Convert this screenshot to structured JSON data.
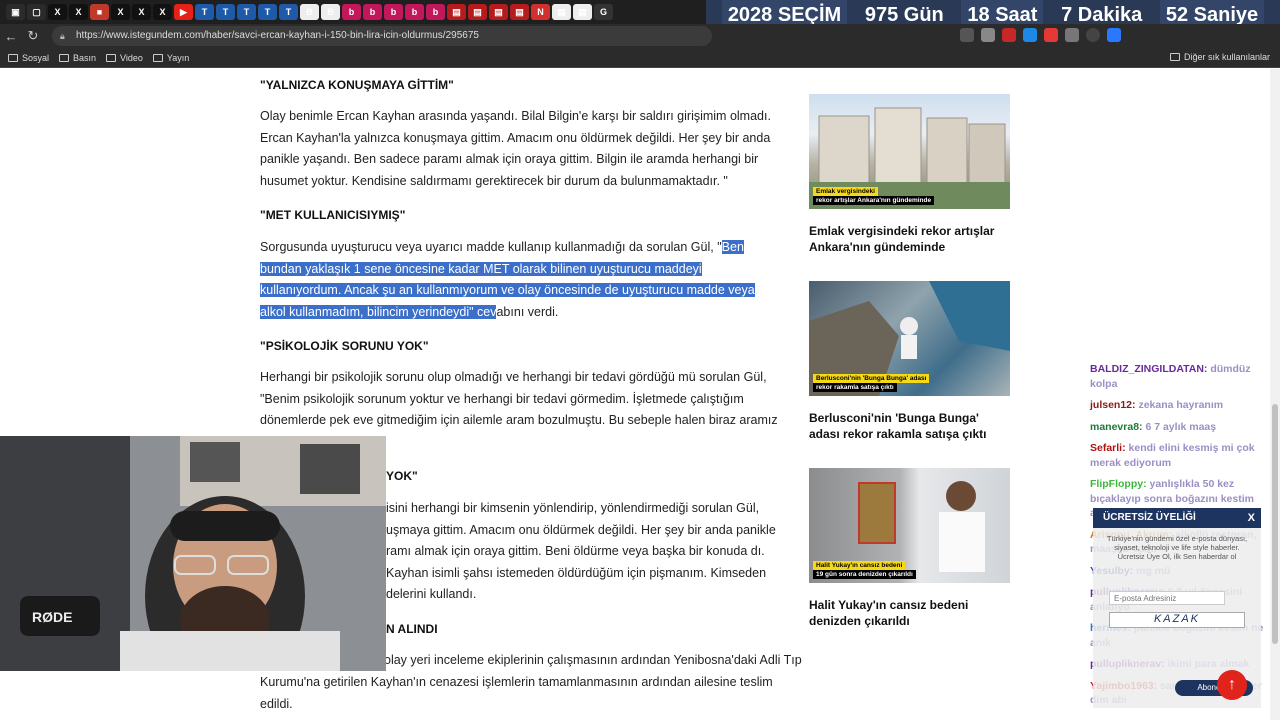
{
  "browser": {
    "tabs": [
      {
        "icon": "tab-icon",
        "color": "#2b2b2b",
        "glyph": "▣"
      },
      {
        "icon": "tab-icon",
        "color": "#2b2b2b",
        "glyph": "▢"
      },
      {
        "icon": "x-icon",
        "color": "#111",
        "glyph": "X"
      },
      {
        "icon": "x-icon",
        "color": "#111",
        "glyph": "X"
      },
      {
        "icon": "red-icon",
        "color": "#c0392b",
        "glyph": "■"
      },
      {
        "icon": "x-icon",
        "color": "#111",
        "glyph": "X"
      },
      {
        "icon": "x-icon",
        "color": "#111",
        "glyph": "X"
      },
      {
        "icon": "x-icon",
        "color": "#111",
        "glyph": "X"
      },
      {
        "icon": "youtube-icon",
        "color": "#e62117",
        "glyph": "▶"
      },
      {
        "icon": "t24-icon",
        "color": "#1e5aa8",
        "glyph": "T"
      },
      {
        "icon": "t24-icon",
        "color": "#1e5aa8",
        "glyph": "T"
      },
      {
        "icon": "t24-icon",
        "color": "#1e5aa8",
        "glyph": "T"
      },
      {
        "icon": "t24-icon",
        "color": "#1e5aa8",
        "glyph": "T"
      },
      {
        "icon": "t24-icon",
        "color": "#1e5aa8",
        "glyph": "T"
      },
      {
        "icon": "b-icon",
        "color": "#eee",
        "glyph": "B"
      },
      {
        "icon": "b-icon",
        "color": "#eee",
        "glyph": "B"
      },
      {
        "icon": "b-icon",
        "color": "#c2185b",
        "glyph": "b"
      },
      {
        "icon": "b-icon",
        "color": "#c2185b",
        "glyph": "b"
      },
      {
        "icon": "b-icon",
        "color": "#c2185b",
        "glyph": "b"
      },
      {
        "icon": "b-icon",
        "color": "#c2185b",
        "glyph": "b"
      },
      {
        "icon": "b-icon",
        "color": "#c2185b",
        "glyph": "b"
      },
      {
        "icon": "news-icon",
        "color": "#b71c1c",
        "glyph": "▤"
      },
      {
        "icon": "news-icon",
        "color": "#b71c1c",
        "glyph": "▤"
      },
      {
        "icon": "news-icon",
        "color": "#b71c1c",
        "glyph": "▤"
      },
      {
        "icon": "news-icon",
        "color": "#b71c1c",
        "glyph": "▤"
      },
      {
        "icon": "n-icon",
        "color": "#d32f2f",
        "glyph": "N"
      },
      {
        "icon": "doc-icon",
        "color": "#eee",
        "glyph": "▤"
      },
      {
        "icon": "doc-icon",
        "color": "#eee",
        "glyph": "▤"
      },
      {
        "icon": "g-icon",
        "color": "#333",
        "glyph": "G"
      }
    ],
    "countdown": {
      "year_label": "2028",
      "title": "SEÇİM",
      "days": "975 Gün",
      "hours": "18 Saat",
      "minutes": "7 Dakika",
      "seconds": "52 Saniye"
    },
    "url": "https://www.istegundem.com/haber/savci-ercan-kayhan-i-150-bin-lira-icin-oldurmus/295675",
    "bookmarks": [
      "Sosyal",
      "Basın",
      "Video",
      "Yayın"
    ],
    "bookmarks_other": "Diğer sık kullanılanlar"
  },
  "article": {
    "h1": "\"YALNIZCA KONUŞMAYA GİTTİM\"",
    "p1": "Olay benimle Ercan Kayhan arasında yaşandı. Bilal Bilgin'e karşı bir saldırı girişimim olmadı. Ercan Kayhan'la yalnızca konuşmaya gittim. Amacım onu öldürmek değildi. Her şey bir anda panikle yaşandı. Ben sadece paramı almak için oraya gittim. Bilgin ile aramda herhangi bir husumet yoktur. Kendisine saldırmamı gerektirecek bir durum da bulunmamaktadır. \"",
    "h2": "\"MET KULLANICISIYMIŞ\"",
    "p2_start": "Sorgusunda uyuşturucu veya uyarıcı madde kullanıp kullanmadığı da sorulan Gül, \"",
    "p2_highlight": "Ben bundan yaklaşık 1 sene öncesine kadar MET olarak bilinen uyuşturucu maddeyi kullanıyordum. Ancak şu an kullanmıyorum ve olay öncesinde de uyuşturucu madde veya alkol kullanmadım, bilincim yerindeydi\" cev",
    "p2_end": "abını verdi.",
    "h3": "\"PSİKOLOJİK SORUNU YOK\"",
    "p3": "Herhangi bir psikolojik sorunu olup olmadığı ve herhangi bir tedavi gördüğü mü sorulan Gül, \"Benim psikolojik sorunum yoktur ve herhangi bir tedavi görmedim. İşletmede çalıştığım dönemlerde pek eve gitmediğim için ailemle aram bozulmuştu. Bu sebeple halen biraz aramız",
    "h4": "YOK\"",
    "p4": "isini herhangi bir kimsenin yönlendirip, yönlendirmediği sorulan Gül, uşmaya gittim. Amacım onu öldürmek değildi. Her şey bir anda panikle ramı almak için oraya gittim. Beni öldürme veya başka bir konuda dı. Kayhan isimli şahsı istemeden öldürdüğüm için pişmanım. Kimseden delerini kullandı.",
    "h5": "N ALINDI",
    "p5_a": "olay yeri inceleme ekiplerinin çalışmasının ardından Yenibosna'daki Adli Tıp",
    "p5_b": "Kurumu'na getirilen Kayhan'ın cenazesi işlemlerin tamamlanmasının ardından ailesine teslim edildi."
  },
  "sidebar": [
    {
      "title": "Emlak vergisindeki rekor artışlar Ankara'nın gündeminde",
      "cap_y": "Emlak vergisindeki",
      "cap_b": "rekor artışlar Ankara'nın gündeminde"
    },
    {
      "title": "Berlusconi'nin 'Bunga Bunga' adası rekor rakamla satışa çıktı",
      "cap_y": "Berlusconi'nin 'Bunga Bunga' adası",
      "cap_b": "rekor rakamla satışa çıktı"
    },
    {
      "title": "Halit Yukay'ın cansız bedeni denizden çıkarıldı",
      "cap_y": "Halit Yukay'ın cansız bedeni",
      "cap_b": "19 gün sonra denizden çıkarıldı"
    }
  ],
  "chat": [
    {
      "user": "BALDIZ_ZINGILDATAN:",
      "text": "dümdüz kolpa",
      "ucolor": "#6a2a9a"
    },
    {
      "user": "julsen12:",
      "text": "zekana hayranım",
      "ucolor": "#8b1a1a"
    },
    {
      "user": "manevra8:",
      "text": "6 7 aylık maaş",
      "ucolor": "#1d7a3a"
    },
    {
      "user": "Sefarli:",
      "text": "kendi elini kesmiş mi çok merak ediyorum",
      "ucolor": "#b31010"
    },
    {
      "user": "FlipFloppy:",
      "text": "yanlışlıkla 50 kez bıçaklayıp sonra boğazını kestim anlaşıldı",
      "ucolor": "#3bb83b"
    },
    {
      "user": "Arisonu_Akrum:",
      "text": "alkollü restoran, maaşlar vadır",
      "ucolor": "#c77c0f"
    },
    {
      "user": "Yesulby:",
      "text": "mg mü",
      "ucolor": "#2e4ba0"
    },
    {
      "user": "pullupliknerav:",
      "text": "6.9 yıl öncesini anlatıyo",
      "ucolor": "#6a2a9a"
    },
    {
      "user": "hermes:",
      "text": "panikle boğazını kesim ne anık",
      "ucolor": "#2e73c9"
    },
    {
      "user": "pullupliknerav:",
      "text": "ikimi para almak",
      "ucolor": "#6a2a9a"
    },
    {
      "user": "Yajimbo1963:",
      "text": "samimiyetimi göster dim abi",
      "ucolor": "#c92020"
    }
  ],
  "popup": {
    "title": "ÜCRETSİZ ÜYELİĞİ",
    "close": "X",
    "desc": "Türkiye'nin gündemi özel e-posta dünyası, siyaset, teknoloji ve life style haberler. Ücretsiz Üye Ol, ilk Sen haberdar ol",
    "email_placeholder": "E-posta Adresiniz",
    "captcha": "KAZAK",
    "submit": "Abone Ol"
  }
}
